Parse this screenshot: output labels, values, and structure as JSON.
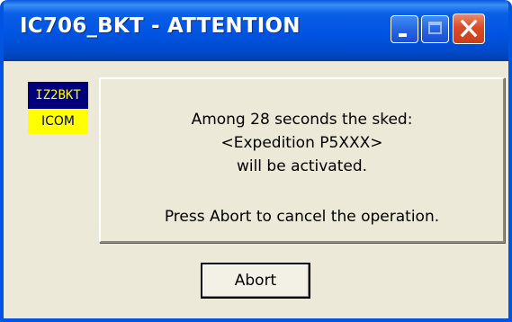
{
  "window": {
    "title": "IC706_BKT - ATTENTION"
  },
  "titlebar_buttons": {
    "minimize_icon": "minimize-icon",
    "maximize_icon": "maximize-icon",
    "close_icon": "close-icon"
  },
  "badges": {
    "callsign": "IZ2BKT",
    "brand": "ICOM"
  },
  "message": {
    "line1": "Among 28 seconds the sked:",
    "line2": "<Expedition P5XXX>",
    "line3": "will be activated.",
    "line4": "Press Abort to cancel the operation."
  },
  "buttons": {
    "abort_label": "Abort"
  },
  "colors": {
    "titlebar": "#0054e3",
    "window_bg": "#ece9d8",
    "close_button": "#db4b25",
    "callsign_bg": "#00007b",
    "callsign_fg": "#ffff00"
  }
}
